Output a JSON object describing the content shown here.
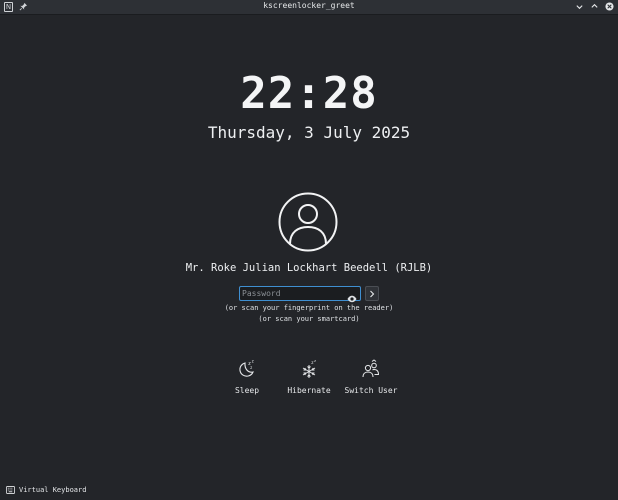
{
  "window": {
    "title": "kscreenlocker_greet"
  },
  "lock": {
    "time": "22:28",
    "date": "Thursday, 3 July 2025",
    "user_name": "Mr. Roke Julian Lockhart Beedell (RJLB)",
    "password_placeholder": "Password",
    "password_value": "",
    "hint_fingerprint": "(or scan your fingerprint on the reader)",
    "hint_smartcard": "(or scan your smartcard)"
  },
  "actions": [
    {
      "label": "Sleep",
      "icon": "sleep-icon"
    },
    {
      "label": "Hibernate",
      "icon": "hibernate-icon"
    },
    {
      "label": "Switch User",
      "icon": "switch-user-icon"
    }
  ],
  "footer": {
    "virtual_keyboard_label": "Virtual Keyboard"
  },
  "colors": {
    "background": "#232529",
    "accent": "#3f8fd1",
    "text": "#eef0f2"
  }
}
